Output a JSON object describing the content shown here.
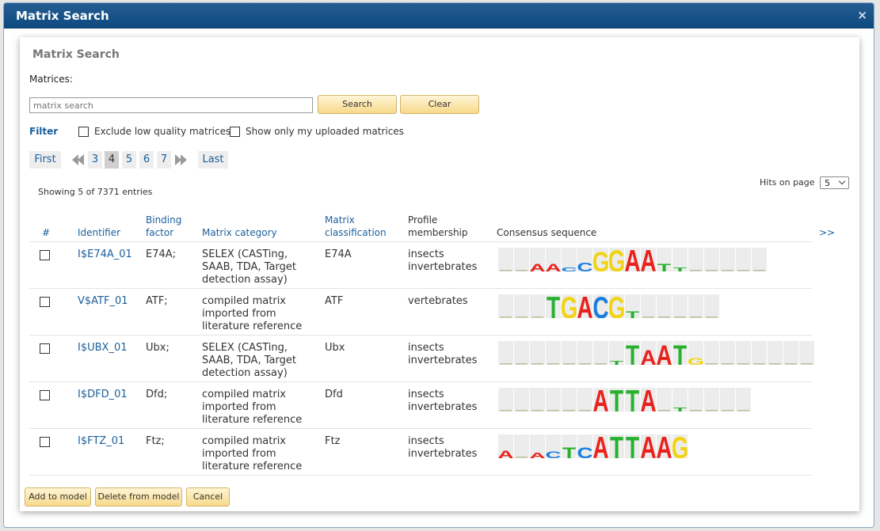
{
  "window": {
    "title": "Matrix Search",
    "close_icon": "×"
  },
  "panel": {
    "title": "Matrix Search"
  },
  "search": {
    "label": "Matrices:",
    "placeholder": "matrix search",
    "search_button": "Search",
    "clear_button": "Clear"
  },
  "filter": {
    "label": "Filter",
    "exclude_low_quality": "Exclude low quality matrices",
    "show_only_uploaded": "Show only my uploaded matrices"
  },
  "pagination": {
    "first": "First",
    "pages": [
      "3",
      "4",
      "5",
      "6",
      "7"
    ],
    "current": "4",
    "last": "Last"
  },
  "status": {
    "showing": "Showing 5 of 7371 entries",
    "hits_label": "Hits on page",
    "hits_value": "5"
  },
  "table": {
    "headers": {
      "num": "#",
      "identifier": "Identifier",
      "binding_1": "Binding",
      "binding_2": "factor",
      "category": "Matrix category",
      "class_1": "Matrix",
      "class_2": "classification",
      "profile_1": "Profile",
      "profile_2": "membership",
      "consensus": "Consensus sequence",
      "more": ">>"
    },
    "rows": [
      {
        "identifier": "I$E74A_01",
        "binding": "E74A;",
        "cat1": "SELEX (CASTing,",
        "cat2": "SAAB, TDA, Target",
        "cat3": "detection assay)",
        "classification": "E74A",
        "prof1": "insects",
        "prof2": "invertebrates",
        "logo": [
          [
            "",
            0
          ],
          [
            "",
            0
          ],
          [
            "A",
            0.35
          ],
          [
            "A",
            0.35
          ],
          [
            "C",
            0.2
          ],
          [
            "C",
            0.4
          ],
          [
            "G",
            0.9
          ],
          [
            "G",
            1
          ],
          [
            "A",
            1
          ],
          [
            "A",
            1
          ],
          [
            "T",
            0.35
          ],
          [
            "T",
            0.2
          ],
          [
            "",
            0
          ],
          [
            "",
            0
          ],
          [
            "",
            0
          ],
          [
            "",
            0
          ],
          [
            "",
            0
          ]
        ]
      },
      {
        "identifier": "V$ATF_01",
        "binding": "ATF;",
        "cat1": "compiled matrix",
        "cat2": "imported from",
        "cat3": "literature reference",
        "classification": "ATF",
        "prof1": "vertebrates",
        "prof2": "",
        "logo": [
          [
            "",
            0
          ],
          [
            "",
            0
          ],
          [
            "",
            0
          ],
          [
            "T",
            1
          ],
          [
            "G",
            1
          ],
          [
            "A",
            1
          ],
          [
            "C",
            1
          ],
          [
            "G",
            1
          ],
          [
            "T",
            0.3
          ],
          [
            "",
            0
          ],
          [
            "",
            0
          ],
          [
            "",
            0
          ],
          [
            "",
            0
          ],
          [
            "",
            0
          ]
        ]
      },
      {
        "identifier": "I$UBX_01",
        "binding": "Ubx;",
        "cat1": "SELEX (CASTing,",
        "cat2": "SAAB, TDA, Target",
        "cat3": "detection assay)",
        "classification": "Ubx",
        "prof1": "insects",
        "prof2": "invertebrates",
        "logo": [
          [
            "",
            0
          ],
          [
            "",
            0
          ],
          [
            "",
            0
          ],
          [
            "",
            0
          ],
          [
            "",
            0
          ],
          [
            "",
            0
          ],
          [
            "",
            0
          ],
          [
            "T",
            0.2
          ],
          [
            "T",
            0.9
          ],
          [
            "A",
            0.7
          ],
          [
            "A",
            0.9
          ],
          [
            "T",
            0.9
          ],
          [
            "G",
            0.3
          ],
          [
            "",
            0
          ],
          [
            "",
            0
          ],
          [
            "",
            0
          ],
          [
            "",
            0
          ],
          [
            "",
            0
          ],
          [
            "",
            0
          ],
          [
            "",
            0
          ]
        ]
      },
      {
        "identifier": "I$DFD_01",
        "binding": "Dfd;",
        "cat1": "compiled matrix",
        "cat2": "imported from",
        "cat3": "literature reference",
        "classification": "Dfd",
        "prof1": "insects",
        "prof2": "invertebrates",
        "logo": [
          [
            "",
            0
          ],
          [
            "",
            0
          ],
          [
            "",
            0
          ],
          [
            "",
            0
          ],
          [
            "",
            0
          ],
          [
            "",
            0
          ],
          [
            "A",
            1
          ],
          [
            "T",
            1
          ],
          [
            "T",
            1
          ],
          [
            "A",
            1
          ],
          [
            "",
            0
          ],
          [
            "T",
            0.2
          ],
          [
            "",
            0
          ],
          [
            "",
            0
          ],
          [
            "",
            0
          ],
          [
            "",
            0
          ]
        ]
      },
      {
        "identifier": "I$FTZ_01",
        "binding": "Ftz;",
        "cat1": "compiled matrix",
        "cat2": "imported from",
        "cat3": "literature reference",
        "classification": "Ftz",
        "prof1": "insects",
        "prof2": "invertebrates",
        "logo": [
          [
            "A",
            0.35
          ],
          [
            "",
            0
          ],
          [
            "A",
            0.25
          ],
          [
            "C",
            0.3
          ],
          [
            "T",
            0.5
          ],
          [
            "C",
            0.5
          ],
          [
            "A",
            1
          ],
          [
            "T",
            1
          ],
          [
            "T",
            1
          ],
          [
            "A",
            1
          ],
          [
            "A",
            1
          ],
          [
            "G",
            1
          ]
        ]
      }
    ]
  },
  "buttons": {
    "add_to_model": "Add to model",
    "delete_from_model": "Delete from model",
    "cancel": "Cancel"
  },
  "colors": {
    "A": "#e8221c",
    "C": "#1a7ee0",
    "G": "#f2d416",
    "T": "#27b12e",
    "empty": "#ececec"
  }
}
